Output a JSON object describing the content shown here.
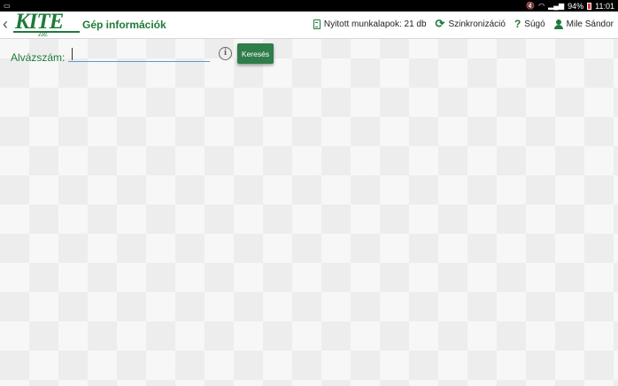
{
  "status_bar": {
    "battery": "94%",
    "time": "11:01"
  },
  "app_bar": {
    "logo_text": "KITE",
    "logo_subtext": "ZRt.",
    "title": "Gép információk",
    "actions": [
      {
        "label": "Nyitott munkalapok: 21 db",
        "icon": "worksheet-icon"
      },
      {
        "label": "Szinkronizáció",
        "icon": "sync-icon"
      },
      {
        "label": "Súgó",
        "icon": "help-icon"
      },
      {
        "label": "Mile Sándor",
        "icon": "user-icon"
      }
    ]
  },
  "form": {
    "chassis_label": "Alvázszám:",
    "chassis_value": "",
    "search_button": "Keresés"
  },
  "colors": {
    "brand_green": "#1f7a3a",
    "button_green": "#2e7d4a",
    "input_underline": "#5a9bd0"
  }
}
